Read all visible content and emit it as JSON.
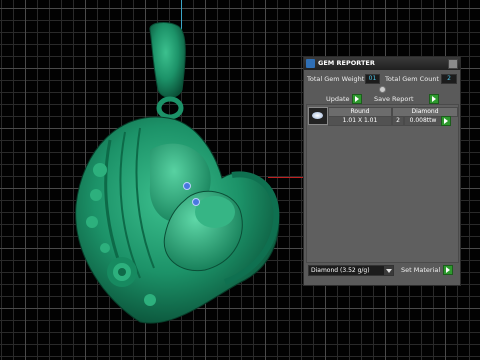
{
  "panel": {
    "title": "GEM REPORTER",
    "total_weight_label": "Total Gem Weight",
    "total_weight_value": "01",
    "total_count_label": "Total Gem Count",
    "total_count_value": "2",
    "update_label": "Update",
    "save_report_label": "Save Report",
    "table": {
      "headers": [
        "Round",
        "Diamond"
      ],
      "row": {
        "size": "1.01 X 1.01",
        "count": "2",
        "weight": "0.008ttw"
      }
    },
    "material_value": "Diamond  (3.52 g/g)",
    "set_material_label": "Set Material"
  },
  "colors": {
    "model": "#1f9a6e",
    "model_dark": "#0c5a3e",
    "panel_bg": "#5a5a5a",
    "field_text": "#4fc6e8",
    "play_green": "#2e9a2e"
  },
  "icons": [
    "gem-reporter-logo-icon",
    "close-icon",
    "play-icon",
    "round-gem-icon",
    "chevron-down-icon"
  ]
}
